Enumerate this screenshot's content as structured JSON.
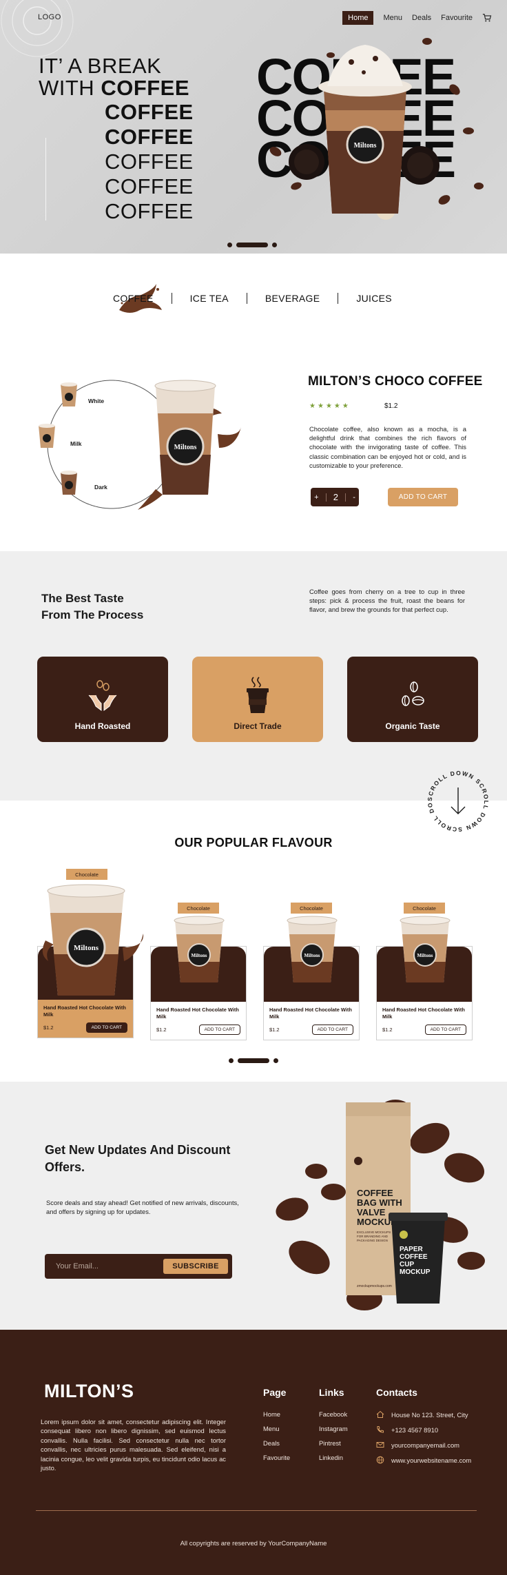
{
  "header": {
    "logo": "LOGO",
    "nav": [
      "Home",
      "Menu",
      "Deals",
      "Favourite"
    ],
    "cart_icon": "cart-icon"
  },
  "hero": {
    "title_line1": "IT’ A BREAK",
    "title_line2_prefix": "WITH ",
    "title_line2_bold": "COFFEE",
    "stack": [
      "COFFEE",
      "COFFEE",
      "COFFEE",
      "COFFEE",
      "COFFEE"
    ],
    "big_words": [
      "COFFEE",
      "COFFEE",
      "COFFEE"
    ],
    "cup_brand": "Miltons"
  },
  "categories": [
    "COFFEE",
    "ICE TEA",
    "BEVERAGE",
    "JUICES"
  ],
  "product": {
    "variants": [
      "White",
      "Milk",
      "Dark"
    ],
    "name": "MILTON’S CHOCO COFFEE",
    "rating": 5,
    "price": "$1.2",
    "description": "Chocolate coffee, also known as a mocha, is a delightful drink that combines the rich flavors of chocolate with the invigorating taste of coffee. This classic combination can be enjoyed hot or cold, and is customizable to your preference.",
    "qty_minus": "+",
    "qty_value": "2",
    "qty_plus": "-",
    "add_to_cart": "ADD TO CART"
  },
  "process": {
    "title_line1": "The Best Taste",
    "title_line2": "From The Process",
    "text": "Coffee goes from cherry on a tree to cup in three steps: pick & process the fruit, roast the beans for flavor, and brew the grounds for that perfect cup.",
    "cards": [
      "Hand Roasted",
      "Direct Trade",
      "Organic Taste"
    ]
  },
  "scroll_badge": "SCROLL DOWN SCROLL DOWN SCROLL DOWN",
  "popular": {
    "title": "OUR POPULAR FLAVOUR",
    "items": [
      {
        "tag": "Chocolate",
        "name": "Hand Roasted Hot Chocolate With Milk",
        "price": "$1.2",
        "button": "ADD TO CART"
      },
      {
        "tag": "Chocolate",
        "name": "Hand Roasted Hot Chocolate With Milk",
        "price": "$1.2",
        "button": "ADD TO CART"
      },
      {
        "tag": "Chocolate",
        "name": "Hand Roasted Hot Chocolate With Milk",
        "price": "$1.2",
        "button": "ADD TO CART"
      },
      {
        "tag": "Chocolate",
        "name": "Hand Roasted Hot Chocolate With Milk",
        "price": "$1.2",
        "button": "ADD TO CART"
      }
    ]
  },
  "newsletter": {
    "title": "Get New Updates And Discount Offers.",
    "text": "Score deals and stay ahead! Get notified of new arrivals, discounts, and offers by signing up for updates.",
    "email_placeholder": "Your Email...",
    "button": "SUBSCRIBE",
    "bag_title": "COFFEE BAG WITH VALVE MOCKUP",
    "bag_sub": "EXCLUSIVE MOCKUPS FOR BRANDING AND PACKAGING DESIGN",
    "bag_url": "zmockupmockups.com",
    "cup_title": "PAPER COFFEE CUP MOCKUP"
  },
  "footer": {
    "brand": "MILTON’S",
    "about": "Lorem ipsum dolor sit amet, consectetur adipiscing elit. Integer consequat libero non libero dignissim, sed euismod lectus convallis. Nulla facilisi. Sed consectetur nulla nec tortor convallis, nec ultricies purus malesuada. Sed eleifend, nisi a lacinia congue, leo velit gravida turpis, eu tincidunt odio lacus ac justo.",
    "page_title": "Page",
    "page_links": [
      "Home",
      "Menu",
      "Deals",
      "Favourite"
    ],
    "links_title": "Links",
    "links": [
      "Facebook",
      "Instagram",
      "Pintrest",
      "Linkedin"
    ],
    "contacts_title": "Contacts",
    "contacts": [
      "House No 123. Street, City",
      "+123 4567 8910",
      "yourcompanyemail.com",
      "www.yourwebsitename.com"
    ],
    "copyright": "All copyrights are reserved by YourCompanyName"
  },
  "colors": {
    "brand_dark": "#3b1f16",
    "accent_tan": "#d9a064",
    "star_green": "#7ea03a",
    "section_grey": "#efefef"
  }
}
